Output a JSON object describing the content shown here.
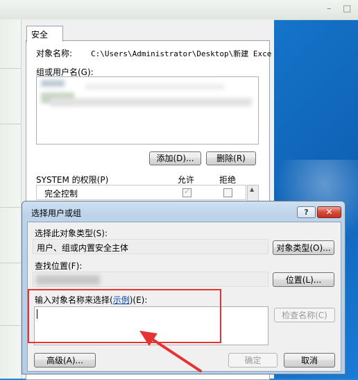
{
  "colors": {
    "desktop": "#1a7cd6",
    "dialog_frame": "#bcd3ea",
    "highlight": "#e53333",
    "arrow": "#e53333"
  },
  "title_strip": {
    "minimize": "–",
    "maximize": "□"
  },
  "security": {
    "tab_label": "安全",
    "object_name_label": "对象名称:",
    "object_name_value": "C:\\Users\\Administrator\\Desktop\\新建 Exce",
    "group_label": "组或用户名(G):",
    "add_button": "添加(D)...",
    "remove_button": "删除(R)",
    "perm_header": "SYSTEM 的权限(P)",
    "col_allow": "允许",
    "col_deny": "拒绝",
    "perm_row": "完全控制",
    "perm_allow": true,
    "perm_deny": false
  },
  "dialog": {
    "title": "选择用户或组",
    "help_button": "?",
    "close_button": "✕",
    "object_type_label": "选择此对象类型(S):",
    "object_type_value": "用户、组或内置安全主体",
    "object_type_button": "对象类型(O)...",
    "location_label": "查找位置(F):",
    "location_button": "位置(L)...",
    "enter_label_prefix": "输入对象名称来选择(",
    "examples_link": "示例",
    "enter_label_suffix": ")(E):",
    "input_value": "",
    "check_names_button": "检查名称(C)",
    "advanced_button": "高级(A)...",
    "ok_button": "确定",
    "cancel_button": "取消"
  }
}
